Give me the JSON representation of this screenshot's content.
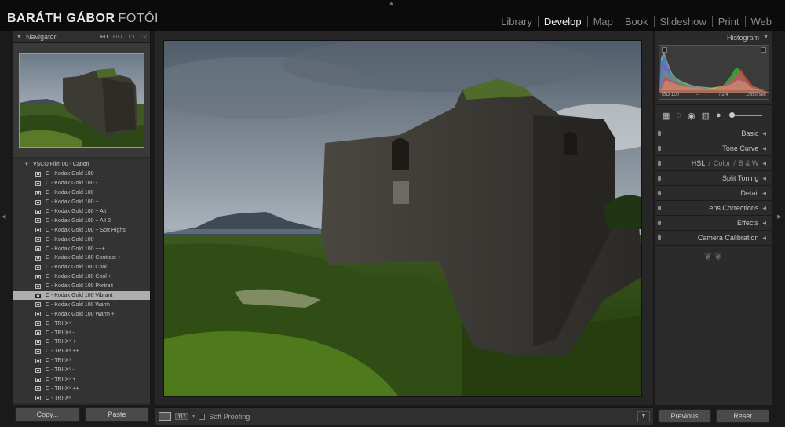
{
  "identity": {
    "name": "BARÁTH GÁBOR",
    "suffix": "FOTÓI"
  },
  "modules": [
    "Library",
    "Develop",
    "Map",
    "Book",
    "Slideshow",
    "Print",
    "Web"
  ],
  "active_module": "Develop",
  "navigator": {
    "title": "Navigator",
    "zoom": [
      "FIT",
      "FILL",
      "1:1",
      "1:2"
    ]
  },
  "presets": {
    "folder": "VSCO Film 00 - Canon",
    "items": [
      "C - Kodak Gold 100",
      "C - Kodak Gold 100 -",
      "C - Kodak Gold 100 - -",
      "C - Kodak Gold 100 +",
      "C - Kodak Gold 100 + Alt",
      "C - Kodak Gold 100 + Alt 2",
      "C - Kodak Gold 100 + Soft Highs",
      "C - Kodak Gold 100 ++",
      "C - Kodak Gold 100 +++",
      "C - Kodak Gold 100 Contrast +",
      "C - Kodak Gold 100 Cool",
      "C - Kodak Gold 100 Cool +",
      "C - Kodak Gold 100 Portrait",
      "C - Kodak Gold 100 Vibrant",
      "C - Kodak Gold 100 Warm",
      "C - Kodak Gold 100 Warm +",
      "C - TRI-X⁴",
      "C - TRI-X⁴ -",
      "C - TRI-X⁴ +",
      "C - TRI-X⁴ ++",
      "C - TRI-X⁵",
      "C - TRI-X⁵ -",
      "C - TRI-X⁵ +",
      "C - TRI-X⁵ ++",
      "C - TRI-X⁶"
    ],
    "selected_index": 13
  },
  "left_buttons": {
    "copy": "Copy...",
    "paste": "Paste"
  },
  "toolbar": {
    "yy": "Y|Y",
    "soft_proofing": "Soft Proofing"
  },
  "histogram": {
    "title": "Histogram",
    "iso": "ISO 100",
    "dash": "–",
    "aperture": "f / 2,4",
    "shutter": "1/850 sec"
  },
  "sections": [
    "Basic",
    "Tone Curve",
    "HSL",
    "Color",
    "B & W",
    "Split Toning",
    "Detail",
    "Lens Corrections",
    "Effects",
    "Camera Calibration"
  ],
  "right_buttons": {
    "previous": "Previous",
    "reset": "Reset"
  },
  "colors": {
    "accent": "#f2f2f2",
    "selected_row": "#aeaeae",
    "panel": "#2b2b2b"
  }
}
